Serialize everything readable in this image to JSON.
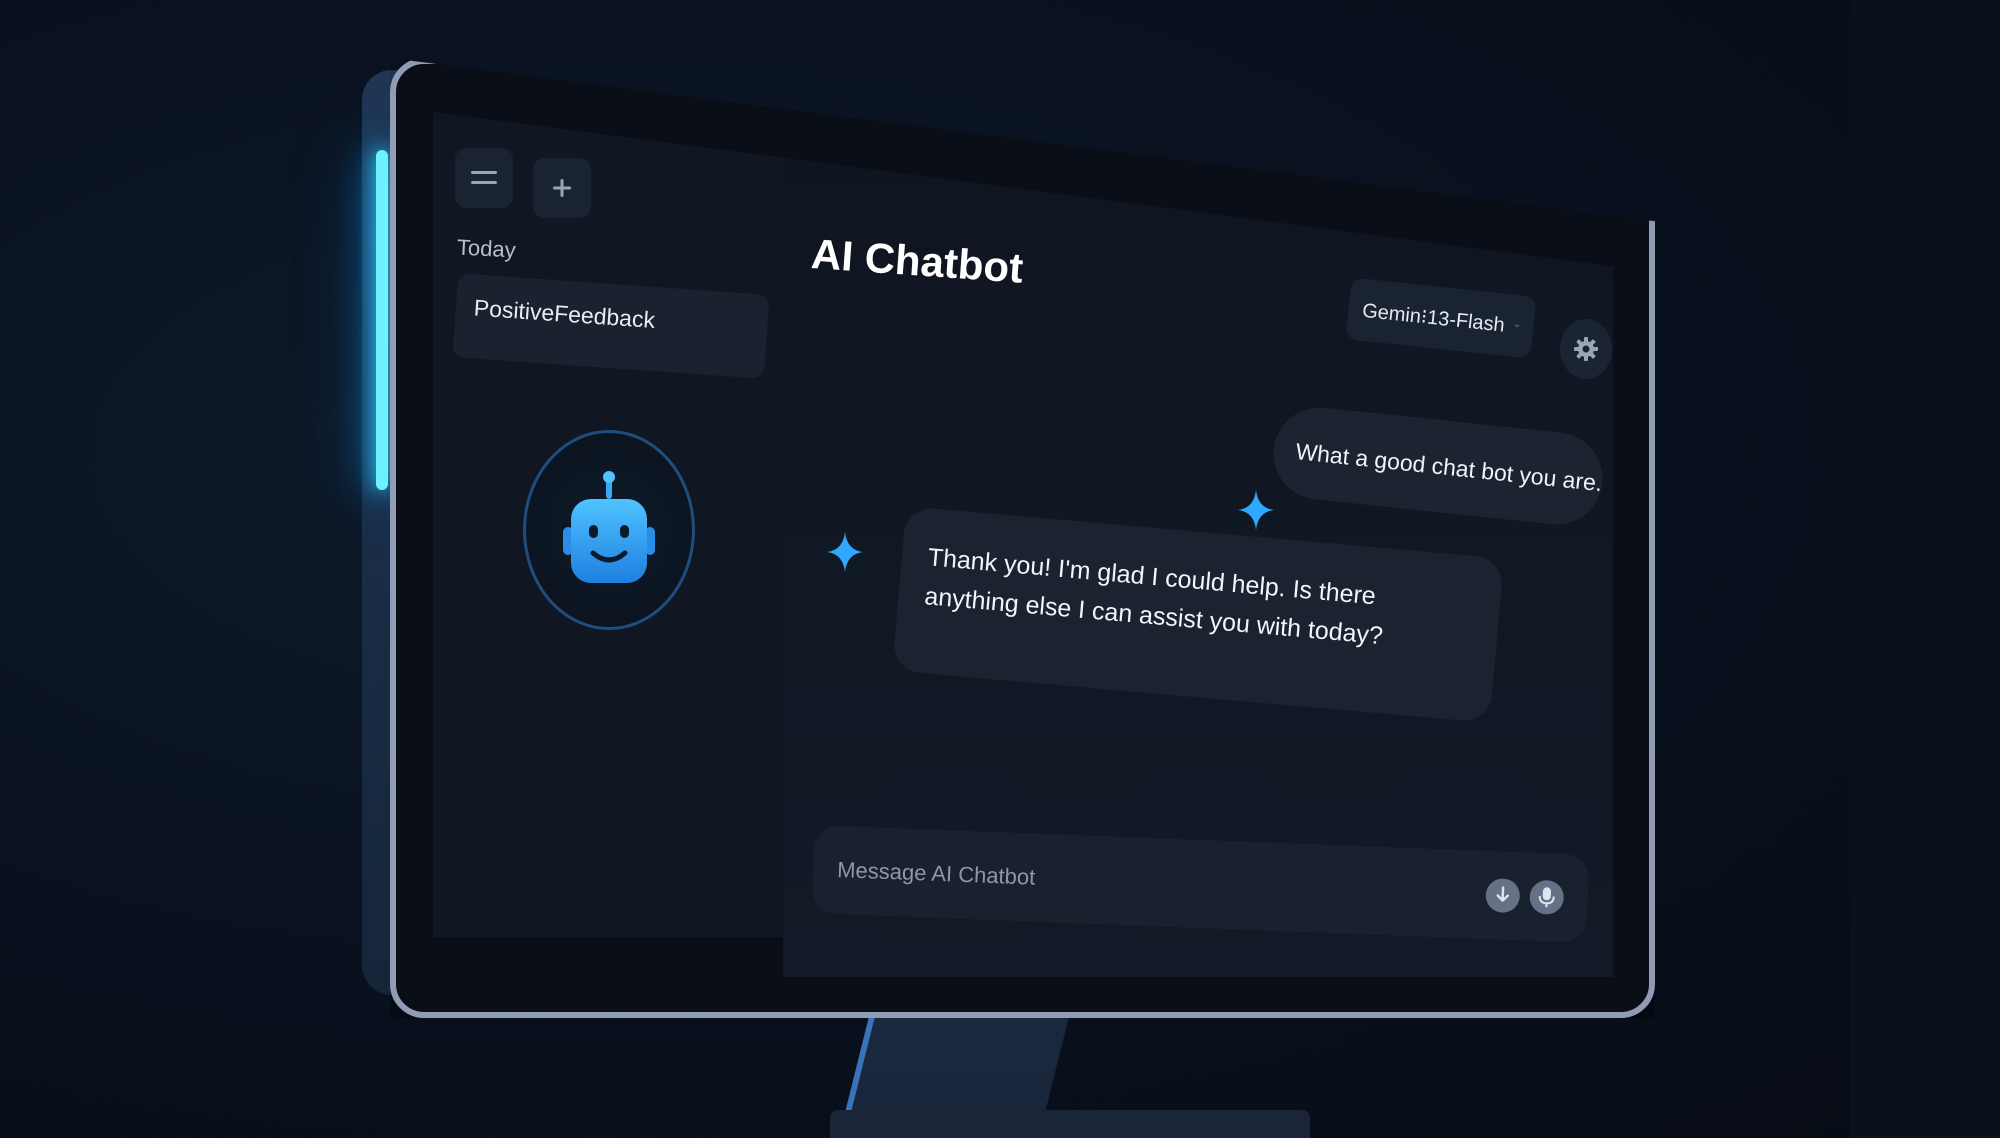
{
  "sidebar": {
    "menu_icon": "menu-icon",
    "new_chat_icon": "plus-icon",
    "section_label": "Today",
    "conversations": [
      {
        "title": "PositiveFeedback"
      }
    ],
    "avatar_icon": "robot-icon"
  },
  "header": {
    "title": "AI Chatbot",
    "model_select": {
      "selected": "Gemin⁝13-Flash",
      "icon": "chevron-down-icon"
    },
    "settings_icon": "gear-icon"
  },
  "messages": [
    {
      "role": "user",
      "text": "What a good chat bot you are."
    },
    {
      "role": "assistant",
      "text": "Thank you! I'm glad I could help. Is there anything else I can assist you with today?"
    }
  ],
  "composer": {
    "placeholder": "Message AI Chatbot",
    "value": "",
    "buttons": [
      "download-icon",
      "microphone-icon"
    ]
  },
  "colors": {
    "accent": "#2fa8ff",
    "glow": "#6ff0ff",
    "bubble": "#1c2432",
    "background": "#0a1220"
  }
}
